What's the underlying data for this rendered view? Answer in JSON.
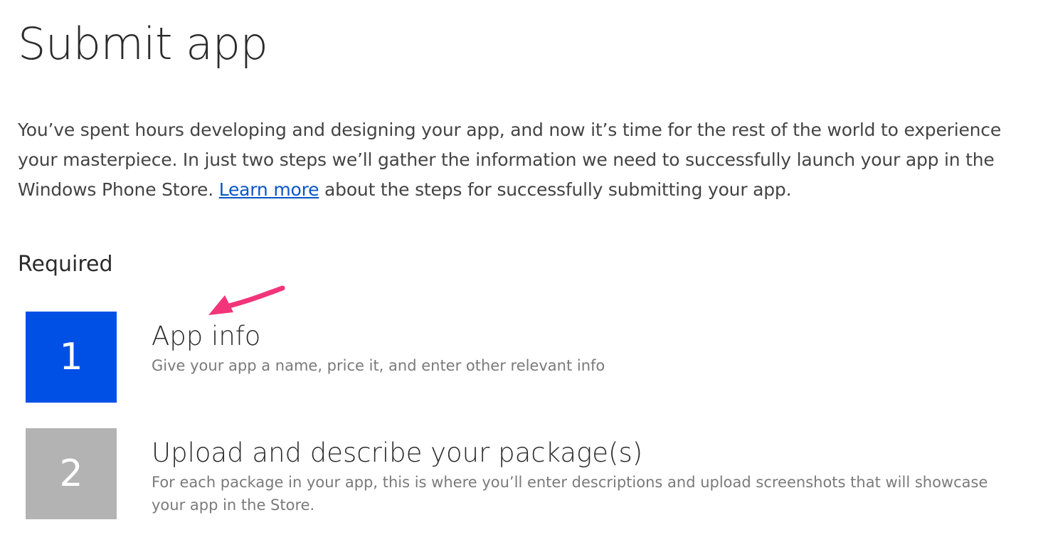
{
  "page": {
    "title": "Submit app",
    "intro_before_link": "You’ve spent hours developing and designing your app, and now it’s time for the rest of the world to experience your masterpiece. In just two steps we’ll gather the information we need to successfully launch your app in the Windows Phone Store. ",
    "intro_link": "Learn more",
    "intro_after_link": " about the steps for successfully submitting your app."
  },
  "required": {
    "heading": "Required",
    "steps": [
      {
        "number": "1",
        "title": "App info",
        "description": "Give your app a name, price it, and enter other relevant info",
        "color": "#0050e6"
      },
      {
        "number": "2",
        "title": "Upload and describe your package(s)",
        "description": "For each package in your app, this is where you’ll enter descriptions and upload screenshots that will showcase your app in the Store.",
        "color": "#b3b3b3"
      }
    ]
  },
  "annotation": {
    "icon": "arrow-pointer-icon",
    "color": "#f2357a"
  }
}
